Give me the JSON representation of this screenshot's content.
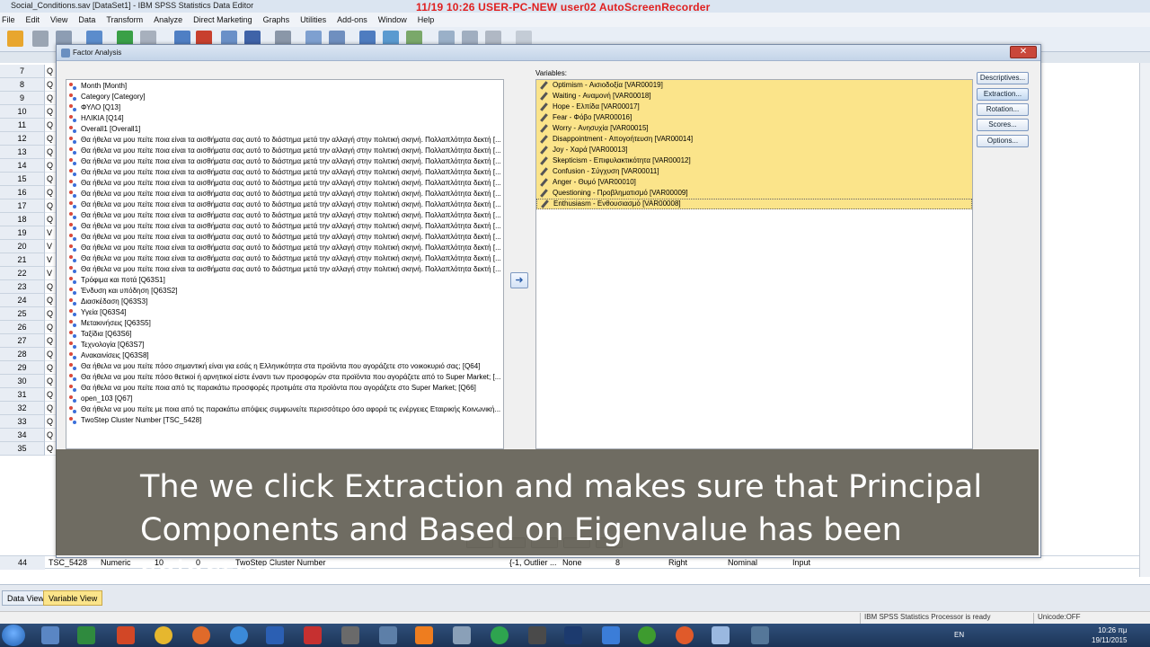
{
  "app": {
    "title": "Social_Conditions.sav [DataSet1] - IBM SPSS Statistics Data Editor",
    "recorder_overlay": "11/19  10:26  USER-PC-NEW  user02  AutoScreenRecorder"
  },
  "menu": [
    "File",
    "Edit",
    "View",
    "Data",
    "Transform",
    "Analyze",
    "Direct Marketing",
    "Graphs",
    "Utilities",
    "Add-ons",
    "Window",
    "Help"
  ],
  "grid": {
    "row_numbers": [
      "7",
      "8",
      "9",
      "10",
      "11",
      "12",
      "13",
      "14",
      "15",
      "16",
      "17",
      "18",
      "19",
      "20",
      "21",
      "22",
      "23",
      "24",
      "25",
      "26",
      "27",
      "28",
      "29",
      "30",
      "31",
      "32",
      "33",
      "34",
      "35"
    ],
    "row_cells": [
      "Q",
      "Q",
      "Q",
      "Q",
      "Q",
      "Q",
      "Q",
      "Q",
      "Q",
      "Q",
      "Q",
      "Q",
      "V",
      "V",
      "V",
      "V",
      "Q",
      "Q",
      "Q",
      "Q",
      "Q",
      "Q",
      "Q",
      "Q",
      "Q",
      "Q",
      "Q",
      "Q",
      "Q"
    ],
    "row44": {
      "num": "44",
      "name": "TSC_5428",
      "type": "Numeric",
      "width": "10",
      "decimals": "0",
      "label": "TwoStep Cluster Number",
      "values": "{-1, Outlier ...",
      "missing": "None",
      "columns": "8",
      "align": "Right",
      "measure": "Nominal",
      "role": "Input"
    }
  },
  "dialog": {
    "title": "Factor Analysis",
    "close_label": "✕",
    "source_variables": [
      "Month [Month]",
      "Category [Category]",
      "ΦΥΛΟ [Q13]",
      "ΗΛΙΚΙΑ [Q14]",
      "Overall1 [Overall1]",
      "Θα ήθελα να μου πείτε ποια είναι τα αισθήματα σας αυτό το διάστημα μετά την αλλαγή στην πολιτική σκηνή. Πολλαπλότητα δεκτή [...",
      "Θα ήθελα να μου πείτε ποια είναι τα αισθήματα σας αυτό το διάστημα μετά την αλλαγή στην πολιτική σκηνή. Πολλαπλότητα δεκτή [...",
      "Θα ήθελα να μου πείτε ποια είναι τα αισθήματα σας αυτό το διάστημα μετά την αλλαγή στην πολιτική σκηνή. Πολλαπλότητα δεκτή [...",
      "Θα ήθελα να μου πείτε ποια είναι τα αισθήματα σας αυτό το διάστημα μετά την αλλαγή στην πολιτική σκηνή. Πολλαπλότητα δεκτή [...",
      "Θα ήθελα να μου πείτε ποια είναι τα αισθήματα σας αυτό το διάστημα μετά την αλλαγή στην πολιτική σκηνή. Πολλαπλότητα δεκτή [...",
      "Θα ήθελα να μου πείτε ποια είναι τα αισθήματα σας αυτό το διάστημα μετά την αλλαγή στην πολιτική σκηνή. Πολλαπλότητα δεκτή [...",
      "Θα ήθελα να μου πείτε ποια είναι τα αισθήματα σας αυτό το διάστημα μετά την αλλαγή στην πολιτική σκηνή. Πολλαπλότητα δεκτή [...",
      "Θα ήθελα να μου πείτε ποια είναι τα αισθήματα σας αυτό το διάστημα μετά την αλλαγή στην πολιτική σκηνή. Πολλαπλότητα δεκτή [...",
      "Θα ήθελα να μου πείτε ποια είναι τα αισθήματα σας αυτό το διάστημα μετά την αλλαγή στην πολιτική σκηνή. Πολλαπλότητα δεκτή [...",
      "Θα ήθελα να μου πείτε ποια είναι τα αισθήματα σας αυτό το διάστημα μετά την αλλαγή στην πολιτική σκηνή. Πολλαπλότητα δεκτή [...",
      "Θα ήθελα να μου πείτε ποια είναι τα αισθήματα σας αυτό το διάστημα μετά την αλλαγή στην πολιτική σκηνή. Πολλαπλότητα δεκτή [...",
      "Θα ήθελα να μου πείτε ποια είναι τα αισθήματα σας αυτό το διάστημα μετά την αλλαγή στην πολιτική σκηνή. Πολλαπλότητα δεκτή [...",
      "Θα ήθελα να μου πείτε ποια είναι τα αισθήματα σας αυτό το διάστημα μετά την αλλαγή στην πολιτική σκηνή. Πολλαπλότητα δεκτή [...",
      "Τρόφιμα και ποτά [Q63S1]",
      "Ένδυση και υπόδηση [Q63S2]",
      "Διασκέδαση [Q63S3]",
      "Υγεία [Q63S4]",
      "Μετακινήσεις [Q63S5]",
      "Ταξίδια [Q63S6]",
      "Τεχνολογία [Q63S7]",
      "Ανακαινίσεις [Q63S8]",
      "Θα ήθελα να μου πείτε πόσο σημαντική είναι για εσάς η Ελληνικότητα στα προϊόντα που αγοράζετε στο νοικοκυριό σας; [Q64]",
      "Θα ήθελα να μου πείτε πόσο θετικοί ή αρνητικοί είστε έναντι των προσφορών στα προϊόντα που αγοράζετε από το Super Market; [...",
      "Θα ήθελα να μου πείτε ποια από τις παρακάτω προσφορές προτιμάτε στα προϊόντα που αγοράζετε στο Super Market; [Q66]",
      "open_103 [Q67]",
      "Θα ήθελα να μου πείτε με ποια από τις παρακάτω απόψεις συμφωνείτε περισσότερο όσο αφορά τις ενέργειες Εταιρικής Κοινωνική...",
      "TwoStep Cluster Number [TSC_5428]"
    ],
    "move_arrow": "➜",
    "variables_label": "Variables:",
    "selected_variables": [
      "Optimism - Αισιοδοξία [VAR00019]",
      "Waiting - Αναμονή [VAR00018]",
      "Hope - Ελπίδα [VAR00017]",
      "Fear - Φόβο [VAR00016]",
      "Worry - Ανησυχία [VAR00015]",
      "Disappointment - Απογοήτευση [VAR00014]",
      "Joy - Χαρά [VAR00013]",
      "Skepticism - Επιφυλακτικότητα [VAR00012]",
      "Confusion - Σύγχυση [VAR00011]",
      "Anger - Θυμό [VAR00010]",
      "Questioning - Προβληματισμό [VAR00009]",
      "Enthusiasm - Ενθουσιασμό [VAR00008]"
    ],
    "buttons": {
      "descriptives": "Descriptives...",
      "extraction": "Extraction...",
      "rotation": "Rotation...",
      "scores": "Scores...",
      "options": "Options..."
    }
  },
  "caption": "The we click Extraction and makes sure that Principal Components and Based on Eigenvalue has been selected",
  "view_tabs": {
    "data_view": "Data View",
    "variable_view": "Variable View"
  },
  "status": {
    "processor": "IBM SPSS Statistics Processor is ready",
    "unicode": "Unicode:OFF"
  },
  "taskbar": {
    "lang": "EN",
    "time": "10:26 πμ",
    "date": "19/11/2015"
  },
  "colors": {
    "selected_variable_bg": "#fbe48a",
    "recorder_text": "#e02020",
    "caption_bg": "#5a564a"
  }
}
